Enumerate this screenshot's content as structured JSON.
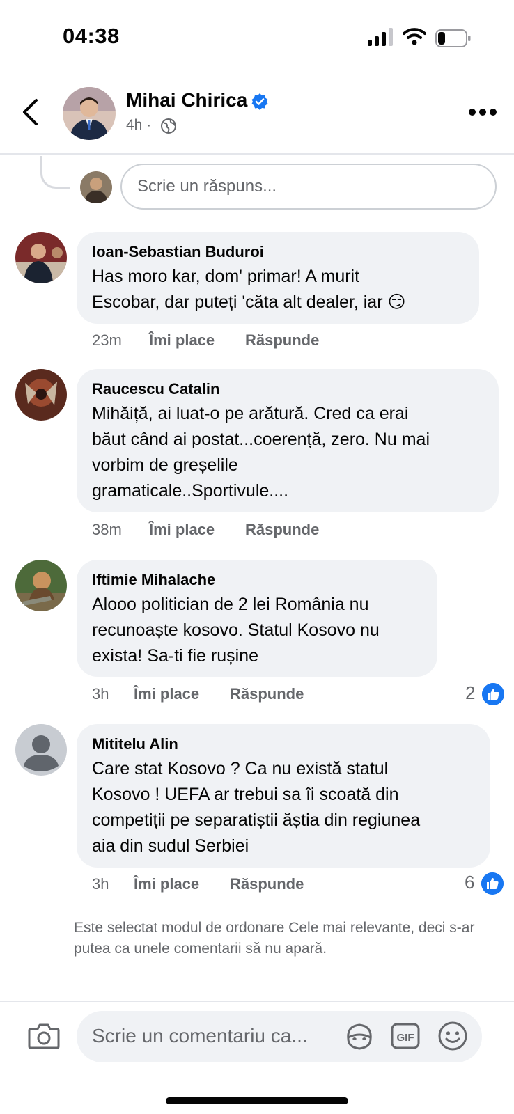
{
  "status_bar": {
    "time": "04:38",
    "battery_level": 0.25
  },
  "header": {
    "author_name": "Mihai Chirica",
    "verified": true,
    "post_time": "4h",
    "audience_icon": "globe-icon"
  },
  "reply_box": {
    "placeholder": "Scrie un răspuns..."
  },
  "comments": [
    {
      "author": "Ioan-Sebastian Buduroi",
      "text_lines": [
        "Has moro kar, dom' primar! A murit",
        "Escobar, dar puteți 'căta alt dealer, iar 😏"
      ],
      "time": "23m",
      "like_label": "Îmi place",
      "reply_label": "Răspunde",
      "likes": ""
    },
    {
      "author": "Raucescu Catalin",
      "text_lines": [
        "Mihăiță, ai luat-o pe arătură. Cred ca erai",
        "băut când ai postat...coerență, zero. Nu mai",
        "vorbim de greșelile",
        "gramaticale..Sportivule...."
      ],
      "time": "38m",
      "like_label": "Îmi place",
      "reply_label": "Răspunde",
      "likes": ""
    },
    {
      "author": "Iftimie Mihalache",
      "text_lines": [
        "Alooo politician de 2 lei România nu",
        "recunoaște kosovo. Statul Kosovo nu",
        "exista! Sa-ti fie rușine"
      ],
      "time": "3h",
      "like_label": "Îmi place",
      "reply_label": "Răspunde",
      "likes": "2"
    },
    {
      "author": "Mititelu Alin",
      "text_lines": [
        "Care stat Kosovo ? Ca nu există statul",
        "Kosovo ! UEFA ar trebui sa îi scoată din",
        "competiții pe separatiștii ăștia din regiunea",
        "aia din sudul Serbiei"
      ],
      "time": "3h",
      "like_label": "Îmi place",
      "reply_label": "Răspunde",
      "likes": "6"
    }
  ],
  "sort_note": "Este selectat modul de ordonare Cele mai relevante, deci s-ar putea ca unele comentarii să nu apară.",
  "composer": {
    "placeholder": "Scrie un comentariu ca..."
  },
  "colors": {
    "accent": "#1877f2",
    "bubble": "#f0f2f5",
    "secondary_text": "#65676b"
  }
}
